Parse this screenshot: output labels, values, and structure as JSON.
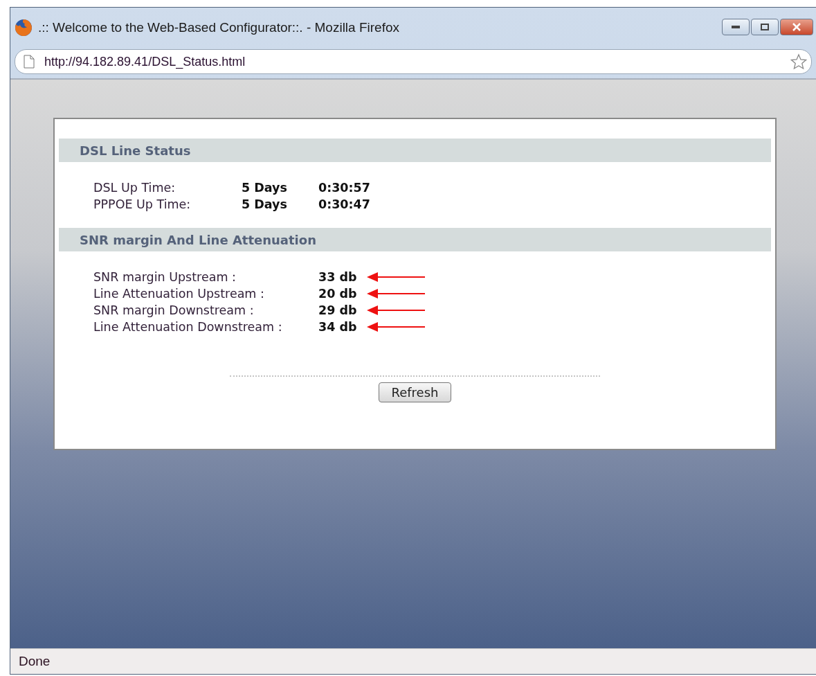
{
  "window": {
    "title": ".:: Welcome to the Web-Based Configurator::. - Mozilla Firefox"
  },
  "address_bar": {
    "url": "http://94.182.89.41/DSL_Status.html"
  },
  "sections": [
    {
      "title": "DSL Line Status",
      "kind": "uptime",
      "rows": [
        {
          "label": "DSL Up Time:",
          "days": "5 Days",
          "time": "0:30:57"
        },
        {
          "label": "PPPOE Up Time:",
          "days": "5 Days",
          "time": "0:30:47"
        }
      ]
    },
    {
      "title": "SNR margin And Line Attenuation",
      "kind": "signal",
      "rows": [
        {
          "label": "SNR margin Upstream :",
          "value": "33 db",
          "arrow": true
        },
        {
          "label": "Line Attenuation Upstream :",
          "value": "20 db",
          "arrow": true
        },
        {
          "label": "SNR margin Downstream :",
          "value": "29 db",
          "arrow": true
        },
        {
          "label": "Line Attenuation Downstream :",
          "value": "34 db",
          "arrow": true
        }
      ]
    }
  ],
  "button": "Refresh",
  "status_bar": "Done"
}
